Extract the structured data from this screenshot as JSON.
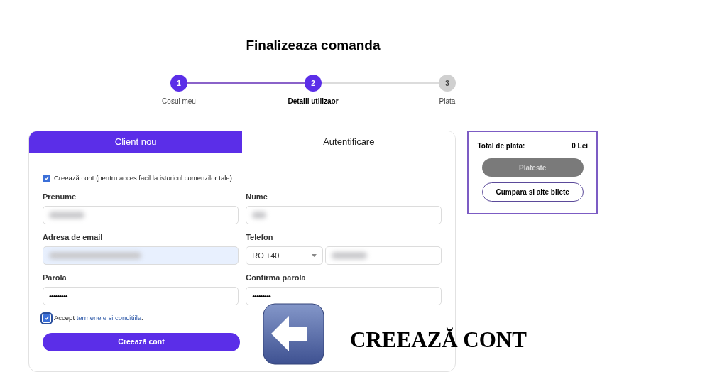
{
  "title": "Finalizeaza comanda",
  "steps": [
    {
      "number": "1",
      "label": "Cosul meu",
      "completed": true,
      "selected": false
    },
    {
      "number": "2",
      "label": "Detalii utilizaor",
      "completed": true,
      "selected": true
    },
    {
      "number": "3",
      "label": "Plata",
      "completed": false,
      "selected": false
    }
  ],
  "tabs": [
    {
      "label": "Client nou",
      "selected": true
    },
    {
      "label": "Autentificare",
      "selected": false
    }
  ],
  "create_account": {
    "label": "Creează cont (pentru acces facil la istoricul comenzilor tale)",
    "checked": true
  },
  "fields": [
    {
      "kind": "text",
      "label": "Prenume",
      "redacted": true
    },
    {
      "kind": "text",
      "label": "Nume",
      "redacted": true
    },
    {
      "kind": "email",
      "label": "Adresa de email",
      "redacted": true,
      "autofilled": true
    },
    {
      "kind": "phone",
      "label": "Telefon",
      "prefix": "RO +40",
      "redacted": true
    },
    {
      "kind": "password",
      "label": "Parola",
      "value": "•••••••••"
    },
    {
      "kind": "password",
      "label": "Confirma parola",
      "value": "•••••••••"
    }
  ],
  "terms": {
    "text": "Accept ",
    "link": "termenele si conditiile",
    "suffix": ".",
    "checked": true,
    "focused": true
  },
  "submit": {
    "label": "Creează cont"
  },
  "summary": {
    "total_label": "Total de plata:",
    "total_value": "0 Lei",
    "pay_button": {
      "label": "Plateste",
      "disabled": true
    },
    "more_button": {
      "label": "Cumpara si alte bilete"
    }
  },
  "annotation": {
    "text": "CREEAZĂ CONT"
  }
}
